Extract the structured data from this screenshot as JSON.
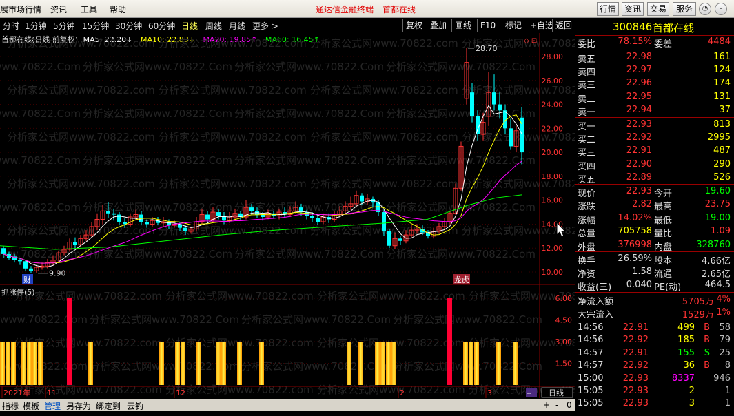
{
  "app": {
    "menu": [
      "展市场行情",
      "资讯",
      "工具",
      "帮助"
    ],
    "notice": [
      "通达信金融终端",
      "首都在线"
    ],
    "top_buttons": [
      "行情",
      "资讯",
      "交易",
      "服务"
    ],
    "win_buttons": [
      "◔",
      "–",
      "▫",
      "✕"
    ]
  },
  "periods": [
    "分时",
    "1分钟",
    "5分钟",
    "15分钟",
    "30分钟",
    "日线",
    "周线",
    "月线",
    "更多 >"
  ],
  "active_period": "日线",
  "chart_tools": [
    "复权",
    "叠加",
    "画线",
    "F10",
    "标记",
    "+自选",
    "返回"
  ],
  "chart_header": {
    "stock_label": "首都在线(日线 前复权)",
    "ma5": "MA5: 22.20↓",
    "ma10": "MA10: 22.83↓",
    "ma20": "MA20: 19.85↑",
    "ma60": "MA60: 16.45↑"
  },
  "chart_annotations": {
    "high": "28.70",
    "low": "9.90",
    "badge1": "财",
    "badge2": "龙虎"
  },
  "volume_indicator": {
    "title": "抓涨停(5)"
  },
  "x_axis_labels": [
    "2021年",
    "11",
    "12",
    "2",
    "3"
  ],
  "y_axis_main": [
    "28.00",
    "26.00",
    "24.00",
    "22.00",
    "20.00",
    "18.00",
    "16.00",
    "14.00",
    "12.00",
    "10.00"
  ],
  "y_axis_vol": [
    "6.00",
    "4.50",
    "3.00",
    "1.50"
  ],
  "period_badge": "日线",
  "zoom_controls": [
    "+",
    "-",
    "0"
  ],
  "bottom_tabs": [
    "指标",
    "模板",
    "管理",
    "另存为",
    "绑定到",
    "云钓"
  ],
  "active_tab": "管理",
  "watermarks": [
    "分析家公式网www.70822.com",
    "分析家公式网www.70822.Com"
  ],
  "quote": {
    "code": "300846",
    "name": "首都在线",
    "weibi_label": "委比",
    "weibi": "78.15%",
    "weicha_label": "委差",
    "weicha": "4484",
    "asks": [
      {
        "label": "卖五",
        "price": "22.98",
        "vol": "161"
      },
      {
        "label": "卖四",
        "price": "22.97",
        "vol": "124"
      },
      {
        "label": "卖三",
        "price": "22.96",
        "vol": "174"
      },
      {
        "label": "卖二",
        "price": "22.95",
        "vol": "131"
      },
      {
        "label": "卖一",
        "price": "22.94",
        "vol": "37"
      }
    ],
    "bids": [
      {
        "label": "买一",
        "price": "22.93",
        "vol": "813"
      },
      {
        "label": "买二",
        "price": "22.92",
        "vol": "2995"
      },
      {
        "label": "买三",
        "price": "22.91",
        "vol": "487"
      },
      {
        "label": "买四",
        "price": "22.90",
        "vol": "290"
      },
      {
        "label": "买五",
        "price": "22.89",
        "vol": "526"
      }
    ],
    "stats": [
      {
        "l1": "现价",
        "v1": "22.93",
        "l2": "今开",
        "v2": "19.60"
      },
      {
        "l1": "涨跌",
        "v1": "2.82",
        "l2": "最高",
        "v2": "23.75"
      },
      {
        "l1": "涨幅",
        "v1": "14.02%",
        "l2": "最低",
        "v2": "19.00"
      },
      {
        "l1": "总量",
        "v1": "705758",
        "l2": "量比",
        "v2": "1.09"
      },
      {
        "l1": "外盘",
        "v1": "376998",
        "l2": "内盘",
        "v2": "328760"
      }
    ],
    "fin": [
      {
        "l1": "换手",
        "v1": "26.59%",
        "l2": "股本",
        "v2": "4.66亿"
      },
      {
        "l1": "净资",
        "v1": "1.58",
        "l2": "流通",
        "v2": "2.65亿"
      },
      {
        "l1": "收益(三)",
        "v1": "0.040",
        "l2": "PE(动)",
        "v2": "464.5"
      }
    ],
    "flow": [
      {
        "label": "净流入额",
        "value": "5705万",
        "pct": "4%"
      },
      {
        "label": "大宗流入",
        "value": "1529万",
        "pct": "1%"
      }
    ],
    "ticks": [
      {
        "time": "14:56",
        "price": "22.91",
        "vol": "499",
        "bs": "B",
        "num": "58"
      },
      {
        "time": "14:56",
        "price": "22.92",
        "vol": "185",
        "bs": "B",
        "num": "79"
      },
      {
        "time": "14:57",
        "price": "22.91",
        "vol": "155",
        "bs": "S",
        "num": "25"
      },
      {
        "time": "14:57",
        "price": "22.92",
        "vol": "36",
        "bs": "B",
        "num": "8"
      },
      {
        "time": "15:00",
        "price": "22.93",
        "vol": "8337",
        "bs": "",
        "num": "946"
      },
      {
        "time": "15:05",
        "price": "22.93",
        "vol": "2",
        "bs": "",
        "num": "1"
      },
      {
        "time": "15:05",
        "price": "22.93",
        "vol": "3",
        "bs": "",
        "num": "1"
      }
    ]
  },
  "colors": {
    "up": "#ff3333",
    "down": "#00ffff",
    "ma5": "#ffffff",
    "ma10": "#ffff00",
    "ma20": "#ff00ff",
    "ma60": "#00ff00",
    "yellow_bar": "#ffcc00",
    "red_bar": "#ff0033"
  }
}
